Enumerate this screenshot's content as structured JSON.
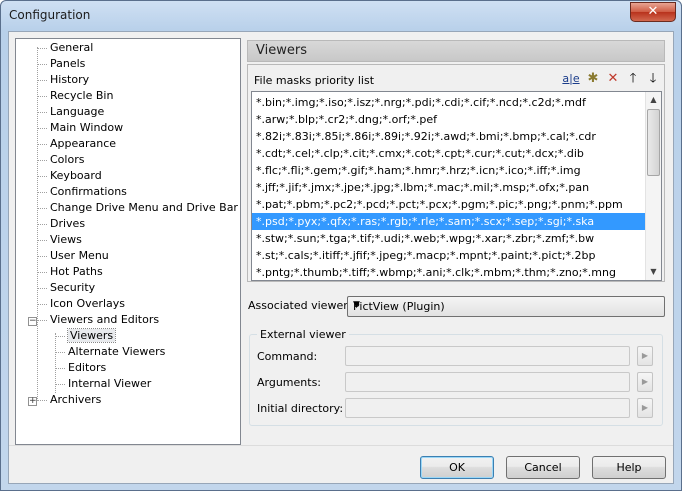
{
  "window": {
    "title": "Configuration",
    "close_glyph": "✕"
  },
  "tree": {
    "items": [
      {
        "label": "General"
      },
      {
        "label": "Panels"
      },
      {
        "label": "History"
      },
      {
        "label": "Recycle Bin"
      },
      {
        "label": "Language"
      },
      {
        "label": "Main Window"
      },
      {
        "label": "Appearance"
      },
      {
        "label": "Colors"
      },
      {
        "label": "Keyboard"
      },
      {
        "label": "Confirmations"
      },
      {
        "label": "Change Drive Menu and Drive Bar"
      },
      {
        "label": "Drives"
      },
      {
        "label": "Views"
      },
      {
        "label": "User Menu"
      },
      {
        "label": "Hot Paths"
      },
      {
        "label": "Security"
      },
      {
        "label": "Icon Overlays"
      },
      {
        "label": "Viewers and Editors"
      },
      {
        "label": "Viewers"
      },
      {
        "label": "Alternate Viewers"
      },
      {
        "label": "Editors"
      },
      {
        "label": "Internal Viewer"
      },
      {
        "label": "Archivers"
      }
    ],
    "expander_open": "−",
    "expander_closed": "+"
  },
  "panel": {
    "title": "Viewers",
    "masks_label": "File masks priority list",
    "toolbar_icons": [
      "rename-icon",
      "new-icon",
      "delete-icon",
      "move-up-icon",
      "move-down-icon"
    ],
    "masks": [
      "*.bin;*.img;*.iso;*.isz;*.nrg;*.pdi;*.cdi;*.cif;*.ncd;*.c2d;*.mdf",
      "*.arw;*.blp;*.cr2;*.dng;*.orf;*.pef",
      "*.82i;*.83i;*.85i;*.86i;*.89i;*.92i;*.awd;*.bmi;*.bmp;*.cal;*.cdr",
      "*.cdt;*.cel;*.clp;*.cit;*.cmx;*.cot;*.cpt;*.cur;*.cut;*.dcx;*.dib",
      "*.flc;*.fli;*.gem;*.gif;*.ham;*.hmr;*.hrz;*.icn;*.ico;*.iff;*.img",
      "*.jff;*.jif;*.jmx;*.jpe;*.jpg;*.lbm;*.mac;*.mil;*.msp;*.ofx;*.pan",
      "*.pat;*.pbm;*.pc2;*.pcd;*.pct;*.pcx;*.pgm;*.pic;*.png;*.pnm;*.ppm",
      "*.psd;*.pyx;*.qfx;*.ras;*.rgb;*.rle;*.sam;*.scx;*.sep;*.sgi;*.ska",
      "*.stw;*.sun;*.tga;*.tif;*.udi;*.web;*.wpg;*.xar;*.zbr;*.zmf;*.bw",
      "*.st;*.cals;*.itiff;*.jfif;*.jpeg;*.macp;*.mpnt;*.paint;*.pict;*.2bp",
      "*.pntg;*.thumb;*.tiff;*.wbmp;*.ani;*.clk;*.mbm;*.thm;*.zno;*.mng"
    ],
    "selected_mask_index": 7,
    "associated_viewer_label": "Associated viewer:",
    "associated_viewer_value": "PictView (Plugin)",
    "external_viewer": {
      "group_label": "External viewer",
      "command_label": "Command:",
      "arguments_label": "Arguments:",
      "initial_dir_label": "Initial directory:",
      "command_value": "",
      "arguments_value": "",
      "initial_dir_value": ""
    }
  },
  "buttons": {
    "ok": "OK",
    "cancel": "Cancel",
    "help": "Help"
  },
  "colors": {
    "selection": "#3399ff",
    "delete_icon": "#c0392b"
  }
}
